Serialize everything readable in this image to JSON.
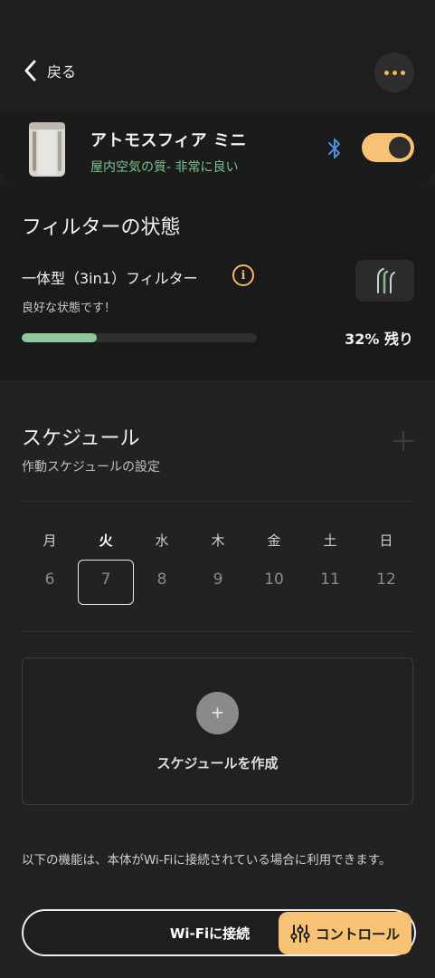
{
  "header": {
    "back_label": "戻る",
    "more_icon": "more-dots-icon"
  },
  "device": {
    "name": "アトモスフィア ミニ",
    "air_quality": "屋内空気の質- 非常に良い",
    "bluetooth_icon": "bluetooth-icon",
    "power_on": true,
    "accent_color": "#f7c274",
    "status_color": "#7bc48e"
  },
  "filter": {
    "title": "フィルターの状態",
    "type": "一体型（3in1）フィルター",
    "state": "良好な状態です！",
    "remaining_fraction": 0.32,
    "remaining_label": "32% 残り",
    "bar_color": "#8fc69e"
  },
  "schedule": {
    "title": "スケジュール",
    "subtitle": "作動スケジュールの設定",
    "days": [
      {
        "label": "月",
        "date": "6",
        "active": false
      },
      {
        "label": "火",
        "date": "7",
        "active": true
      },
      {
        "label": "水",
        "date": "8",
        "active": false
      },
      {
        "label": "木",
        "date": "9",
        "active": false
      },
      {
        "label": "金",
        "date": "10",
        "active": false
      },
      {
        "label": "土",
        "date": "11",
        "active": false
      },
      {
        "label": "日",
        "date": "12",
        "active": false
      }
    ],
    "create_label": "スケジュールを作成"
  },
  "footer": {
    "wifi_note": "以下の機能は、本体がWi-Fiに接続されている場合に利用できます。",
    "wifi_button": "Wi-Fiに接続",
    "control_button": "コントロール"
  }
}
